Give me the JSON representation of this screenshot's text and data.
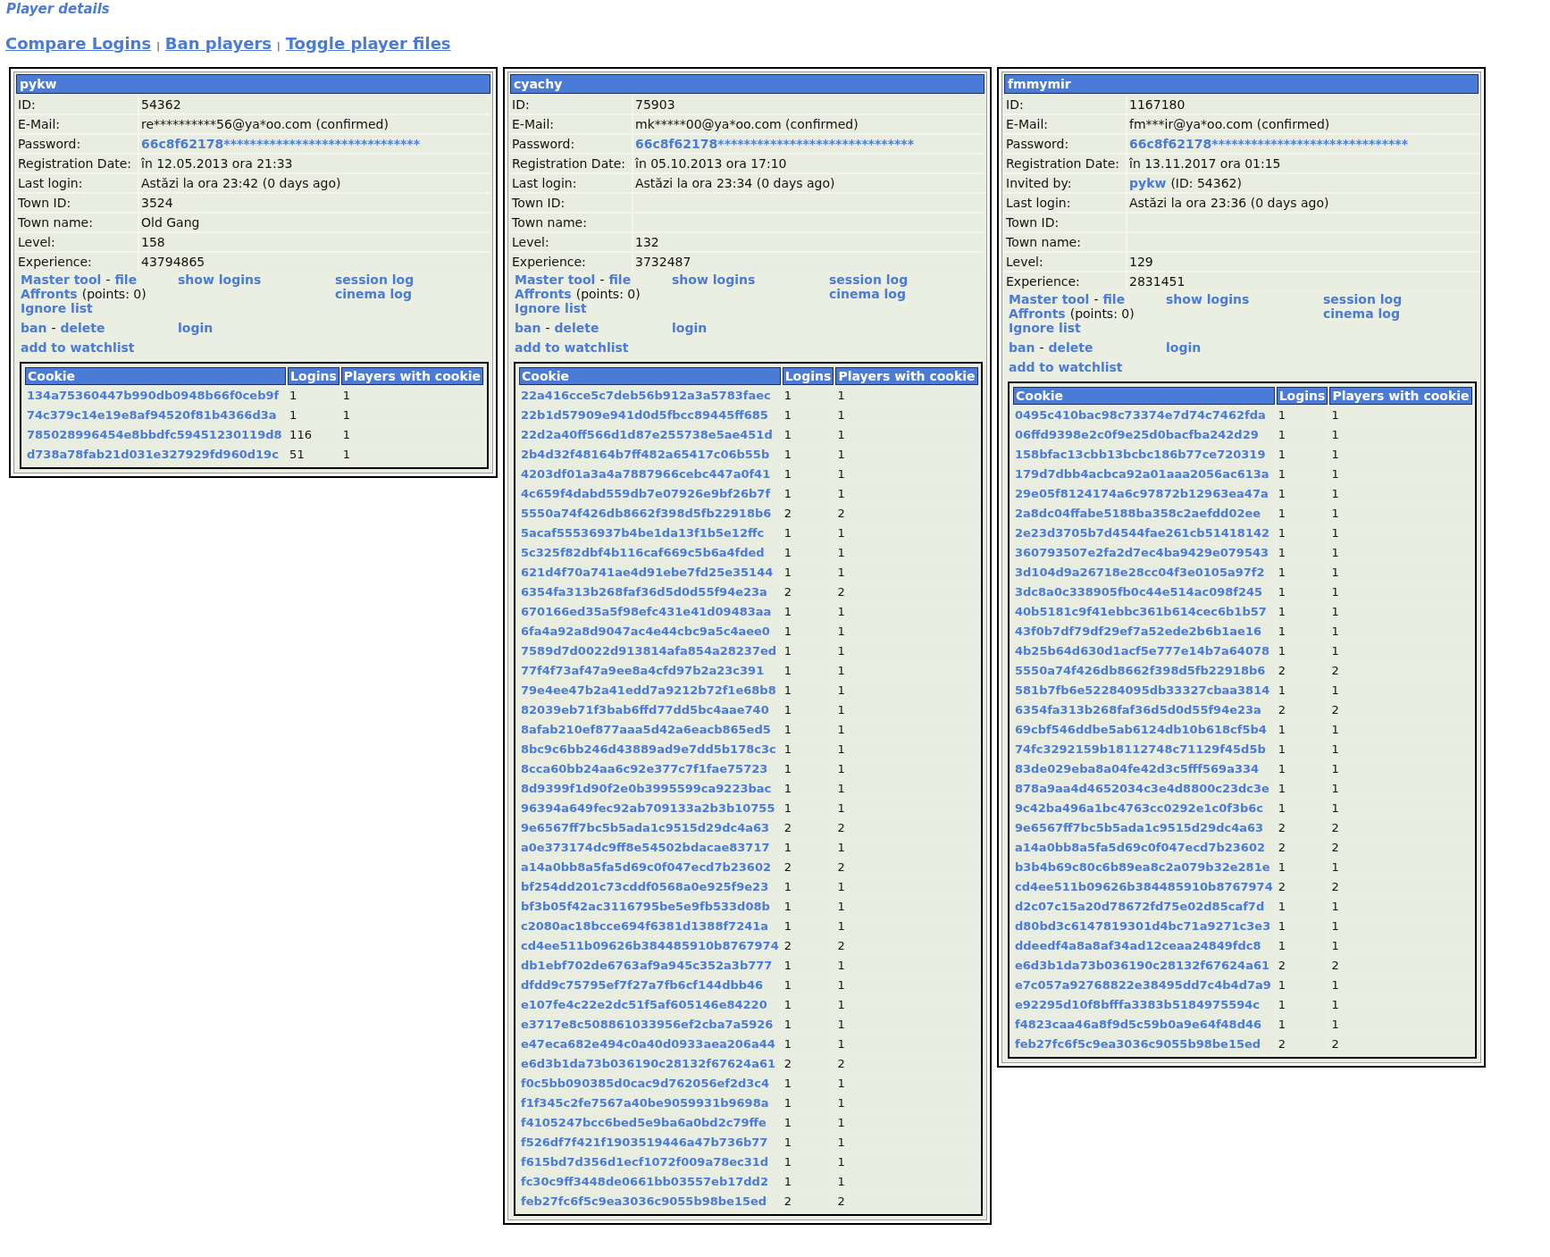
{
  "title": "Player details",
  "nav": [
    {
      "kind": "link",
      "text": "Compare Logins"
    },
    {
      "kind": "separator",
      "text": "|"
    },
    {
      "kind": "link",
      "text": "Ban players"
    },
    {
      "kind": "separator",
      "text": "|"
    },
    {
      "kind": "link",
      "text": "Toggle player files"
    }
  ],
  "players": [
    {
      "name": "pykw",
      "fields": [
        {
          "label": "ID:",
          "value": "54362"
        },
        {
          "label": "E-Mail:",
          "value": "re**********56@ya*oo.com (confirmed)"
        },
        {
          "label": "Password:",
          "link": "66c8f62178******************************"
        },
        {
          "label": "Registration Date:",
          "value": "în 12.05.2013 ora 21:33"
        },
        {
          "label": "Last login:",
          "value": "Astăzi la ora 23:42 (0 days ago)"
        },
        {
          "label": "Town ID:",
          "value": "3524"
        },
        {
          "label": "Town name:",
          "value": "Old Gang"
        },
        {
          "label": "Level:",
          "value": "158"
        },
        {
          "label": "Experience:",
          "value": "43794865"
        }
      ],
      "actions": [
        [
          [
            [
              {
                "text": "Master tool",
                "kind": "link"
              },
              {
                "text": "-",
                "kind": "text"
              },
              {
                "text": "file",
                "kind": "link"
              }
            ],
            [
              {
                "text": "Affronts",
                "kind": "link"
              },
              {
                "text": "(points: 0)",
                "kind": "text"
              }
            ],
            [
              {
                "text": "Ignore list",
                "kind": "link"
              }
            ]
          ],
          [
            [
              {
                "text": "show logins",
                "kind": "link"
              }
            ]
          ],
          [
            [
              {
                "text": "session log",
                "kind": "link"
              }
            ],
            [
              {
                "text": "cinema log",
                "kind": "link"
              }
            ]
          ]
        ],
        [
          [
            [
              {
                "text": "ban",
                "kind": "link"
              },
              {
                "text": "-",
                "kind": "text"
              },
              {
                "text": "delete",
                "kind": "link"
              }
            ]
          ],
          [
            [
              {
                "text": "login",
                "kind": "link"
              }
            ]
          ]
        ],
        [
          [
            [
              {
                "text": "add to watchlist",
                "kind": "link"
              }
            ]
          ]
        ]
      ],
      "columns": [
        "Cookie",
        "Logins",
        "Players with cookie"
      ],
      "cookies": [
        [
          "134a75360447b990db0948b66f0ceb9f",
          "1",
          "1"
        ],
        [
          "74c379c14e19e8af94520f81b4366d3a",
          "1",
          "1"
        ],
        [
          "785028996454e8bbdfc59451230119d8",
          "116",
          "1"
        ],
        [
          "d738a78fab21d031e327929fd960d19c",
          "51",
          "1"
        ]
      ]
    },
    {
      "name": "cyachy",
      "fields": [
        {
          "label": "ID:",
          "value": "75903"
        },
        {
          "label": "E-Mail:",
          "value": "mk*****00@ya*oo.com (confirmed)"
        },
        {
          "label": "Password:",
          "link": "66c8f62178******************************"
        },
        {
          "label": "Registration Date:",
          "value": "în 05.10.2013 ora 17:10"
        },
        {
          "label": "Last login:",
          "value": "Astăzi la ora 23:34 (0 days ago)"
        },
        {
          "label": "Town ID:"
        },
        {
          "label": "Town name:"
        },
        {
          "label": "Level:",
          "value": "132"
        },
        {
          "label": "Experience:",
          "value": "3732487"
        }
      ],
      "actions": [
        [
          [
            [
              {
                "text": "Master tool",
                "kind": "link"
              },
              {
                "text": "-",
                "kind": "text"
              },
              {
                "text": "file",
                "kind": "link"
              }
            ],
            [
              {
                "text": "Affronts",
                "kind": "link"
              },
              {
                "text": "(points: 0)",
                "kind": "text"
              }
            ],
            [
              {
                "text": "Ignore list",
                "kind": "link"
              }
            ]
          ],
          [
            [
              {
                "text": "show logins",
                "kind": "link"
              }
            ]
          ],
          [
            [
              {
                "text": "session log",
                "kind": "link"
              }
            ],
            [
              {
                "text": "cinema log",
                "kind": "link"
              }
            ]
          ]
        ],
        [
          [
            [
              {
                "text": "ban",
                "kind": "link"
              },
              {
                "text": "-",
                "kind": "text"
              },
              {
                "text": "delete",
                "kind": "link"
              }
            ]
          ],
          [
            [
              {
                "text": "login",
                "kind": "link"
              }
            ]
          ]
        ],
        [
          [
            [
              {
                "text": "add to watchlist",
                "kind": "link"
              }
            ]
          ]
        ]
      ],
      "columns": [
        "Cookie",
        "Logins",
        "Players with cookie"
      ],
      "cookies": [
        [
          "22a416cce5c7deb56b912a3a5783faec",
          "1",
          "1"
        ],
        [
          "22b1d57909e941d0d5fbcc89445ff685",
          "1",
          "1"
        ],
        [
          "22d2a40ff566d1d87e255738e5ae451d",
          "1",
          "1"
        ],
        [
          "2b4d32f48164b7ff482a65417c06b55b",
          "1",
          "1"
        ],
        [
          "4203df01a3a4a7887966cebc447a0f41",
          "1",
          "1"
        ],
        [
          "4c659f4dabd559db7e07926e9bf26b7f",
          "1",
          "1"
        ],
        [
          "5550a74f426db8662f398d5fb22918b6",
          "2",
          "2"
        ],
        [
          "5acaf55536937b4be1da13f1b5e12ffc",
          "1",
          "1"
        ],
        [
          "5c325f82dbf4b116caf669c5b6a4fded",
          "1",
          "1"
        ],
        [
          "621d4f70a741ae4d91ebe7fd25e35144",
          "1",
          "1"
        ],
        [
          "6354fa313b268faf36d5d0d55f94e23a",
          "2",
          "2"
        ],
        [
          "670166ed35a5f98efc431e41d09483aa",
          "1",
          "1"
        ],
        [
          "6fa4a92a8d9047ac4e44cbc9a5c4aee0",
          "1",
          "1"
        ],
        [
          "7589d7d0022d913814afa854a28237ed",
          "1",
          "1"
        ],
        [
          "77f4f73af47a9ee8a4cfd97b2a23c391",
          "1",
          "1"
        ],
        [
          "79e4ee47b2a41edd7a9212b72f1e68b8",
          "1",
          "1"
        ],
        [
          "82039eb71f3bab6ffd77dd5bc4aae740",
          "1",
          "1"
        ],
        [
          "8afab210ef877aaa5d42a6eacb865ed5",
          "1",
          "1"
        ],
        [
          "8bc9c6bb246d43889ad9e7dd5b178c3c",
          "1",
          "1"
        ],
        [
          "8cca60bb24aa6c92e377c7f1fae75723",
          "1",
          "1"
        ],
        [
          "8d9399f1d90f2e0b3995599ca9223bac",
          "1",
          "1"
        ],
        [
          "96394a649fec92ab709133a2b3b10755",
          "1",
          "1"
        ],
        [
          "9e6567ff7bc5b5ada1c9515d29dc4a63",
          "2",
          "2"
        ],
        [
          "a0e373174dc9ff8e54502bdacae83717",
          "1",
          "1"
        ],
        [
          "a14a0bb8a5fa5d69c0f047ecd7b23602",
          "2",
          "2"
        ],
        [
          "bf254dd201c73cddf0568a0e925f9e23",
          "1",
          "1"
        ],
        [
          "bf3b05f42ac3116795be5e9fb533d08b",
          "1",
          "1"
        ],
        [
          "c2080ac18bcce694f6381d1388f7241a",
          "1",
          "1"
        ],
        [
          "cd4ee511b09626b384485910b8767974",
          "2",
          "2"
        ],
        [
          "db1ebf702de6763af9a945c352a3b777",
          "1",
          "1"
        ],
        [
          "dfdd9c75795ef7f27a7fb6cf144dbb46",
          "1",
          "1"
        ],
        [
          "e107fe4c22e2dc51f5af605146e84220",
          "1",
          "1"
        ],
        [
          "e3717e8c508861033956ef2cba7a5926",
          "1",
          "1"
        ],
        [
          "e47eca682e494c0a40d0933aea206a44",
          "1",
          "1"
        ],
        [
          "e6d3b1da73b036190c28132f67624a61",
          "2",
          "2"
        ],
        [
          "f0c5bb090385d0cac9d762056ef2d3c4",
          "1",
          "1"
        ],
        [
          "f1f345c2fe7567a40be9059931b9698a",
          "1",
          "1"
        ],
        [
          "f4105247bcc6bed5e9ba6a0bd2c79ffe",
          "1",
          "1"
        ],
        [
          "f526df7f421f1903519446a47b736b77",
          "1",
          "1"
        ],
        [
          "f615bd7d356d1ecf1072f009a78ec31d",
          "1",
          "1"
        ],
        [
          "fc30c9ff3448de0661bb03557eb17dd2",
          "1",
          "1"
        ],
        [
          "feb27fc6f5c9ea3036c9055b98be15ed",
          "2",
          "2"
        ]
      ]
    },
    {
      "name": "fmmymir",
      "fields": [
        {
          "label": "ID:",
          "value": "1167180"
        },
        {
          "label": "E-Mail:",
          "value": "fm***ir@ya*oo.com (confirmed)"
        },
        {
          "label": "Password:",
          "link": "66c8f62178******************************"
        },
        {
          "label": "Registration Date:",
          "value": "în 13.11.2017 ora 01:15"
        },
        {
          "label": "Invited by:",
          "link": "pykw",
          "value": "(ID: 54362)"
        },
        {
          "label": "Last login:",
          "value": "Astăzi la ora 23:36 (0 days ago)"
        },
        {
          "label": "Town ID:"
        },
        {
          "label": "Town name:"
        },
        {
          "label": "Level:",
          "value": "129"
        },
        {
          "label": "Experience:",
          "value": "2831451"
        }
      ],
      "actions": [
        [
          [
            [
              {
                "text": "Master tool",
                "kind": "link"
              },
              {
                "text": "-",
                "kind": "text"
              },
              {
                "text": "file",
                "kind": "link"
              }
            ],
            [
              {
                "text": "Affronts",
                "kind": "link"
              },
              {
                "text": "(points: 0)",
                "kind": "text"
              }
            ],
            [
              {
                "text": "Ignore list",
                "kind": "link"
              }
            ]
          ],
          [
            [
              {
                "text": "show logins",
                "kind": "link"
              }
            ]
          ],
          [
            [
              {
                "text": "session log",
                "kind": "link"
              }
            ],
            [
              {
                "text": "cinema log",
                "kind": "link"
              }
            ]
          ]
        ],
        [
          [
            [
              {
                "text": "ban",
                "kind": "link"
              },
              {
                "text": "-",
                "kind": "text"
              },
              {
                "text": "delete",
                "kind": "link"
              }
            ]
          ],
          [
            [
              {
                "text": "login",
                "kind": "link"
              }
            ]
          ]
        ],
        [
          [
            [
              {
                "text": "add to watchlist",
                "kind": "link"
              }
            ]
          ]
        ]
      ],
      "columns": [
        "Cookie",
        "Logins",
        "Players with cookie"
      ],
      "cookies": [
        [
          "0495c410bac98c73374e7d74c7462fda",
          "1",
          "1"
        ],
        [
          "06ffd9398e2c0f9e25d0bacfba242d29",
          "1",
          "1"
        ],
        [
          "158bfac13cbb13bcbc186b77ce720319",
          "1",
          "1"
        ],
        [
          "179d7dbb4acbca92a01aaa2056ac613a",
          "1",
          "1"
        ],
        [
          "29e05f8124174a6c97872b12963ea47a",
          "1",
          "1"
        ],
        [
          "2a8dc04ffabe5188ba358c2aefdd02ee",
          "1",
          "1"
        ],
        [
          "2e23d3705b7d4544fae261cb51418142",
          "1",
          "1"
        ],
        [
          "360793507e2fa2d7ec4ba9429e079543",
          "1",
          "1"
        ],
        [
          "3d104d9a26718e28cc04f3e0105a97f2",
          "1",
          "1"
        ],
        [
          "3dc8a0c338905fb0c44e514ac098f245",
          "1",
          "1"
        ],
        [
          "40b5181c9f41ebbc361b614cec6b1b57",
          "1",
          "1"
        ],
        [
          "43f0b7df79df29ef7a52ede2b6b1ae16",
          "1",
          "1"
        ],
        [
          "4b25b64d630d1acf5e777e14b7a64078",
          "1",
          "1"
        ],
        [
          "5550a74f426db8662f398d5fb22918b6",
          "2",
          "2"
        ],
        [
          "581b7fb6e52284095db33327cbaa3814",
          "1",
          "1"
        ],
        [
          "6354fa313b268faf36d5d0d55f94e23a",
          "2",
          "2"
        ],
        [
          "69cbf546ddbe5ab6124db10b618cf5b4",
          "1",
          "1"
        ],
        [
          "74fc3292159b18112748c71129f45d5b",
          "1",
          "1"
        ],
        [
          "83de029eba8a04fe42d3c5fff569a334",
          "1",
          "1"
        ],
        [
          "878a9aa4d4652034c3e4d8800c23dc3e",
          "1",
          "1"
        ],
        [
          "9c42ba496a1bc4763cc0292e1c0f3b6c",
          "1",
          "1"
        ],
        [
          "9e6567ff7bc5b5ada1c9515d29dc4a63",
          "2",
          "2"
        ],
        [
          "a14a0bb8a5fa5d69c0f047ecd7b23602",
          "2",
          "2"
        ],
        [
          "b3b4b69c80c6b89ea8c2a079b32e281e",
          "1",
          "1"
        ],
        [
          "cd4ee511b09626b384485910b8767974",
          "2",
          "2"
        ],
        [
          "d2c07c15a20d78672fd75e02d85caf7d",
          "1",
          "1"
        ],
        [
          "d80bd3c6147819301d4bc71a9271c3e3",
          "1",
          "1"
        ],
        [
          "ddeedf4a8a8af34ad12ceaa24849fdc8",
          "1",
          "1"
        ],
        [
          "e6d3b1da73b036190c28132f67624a61",
          "2",
          "2"
        ],
        [
          "e7c057a92768822e38495dd7c4b4d7a9",
          "1",
          "1"
        ],
        [
          "e92295d10f8bfffa3383b5184975594c",
          "1",
          "1"
        ],
        [
          "f4823caa46a8f9d5c59b0a9e64f48d46",
          "1",
          "1"
        ],
        [
          "feb27fc6f5c9ea3036c9055b98be15ed",
          "2",
          "2"
        ]
      ]
    }
  ]
}
